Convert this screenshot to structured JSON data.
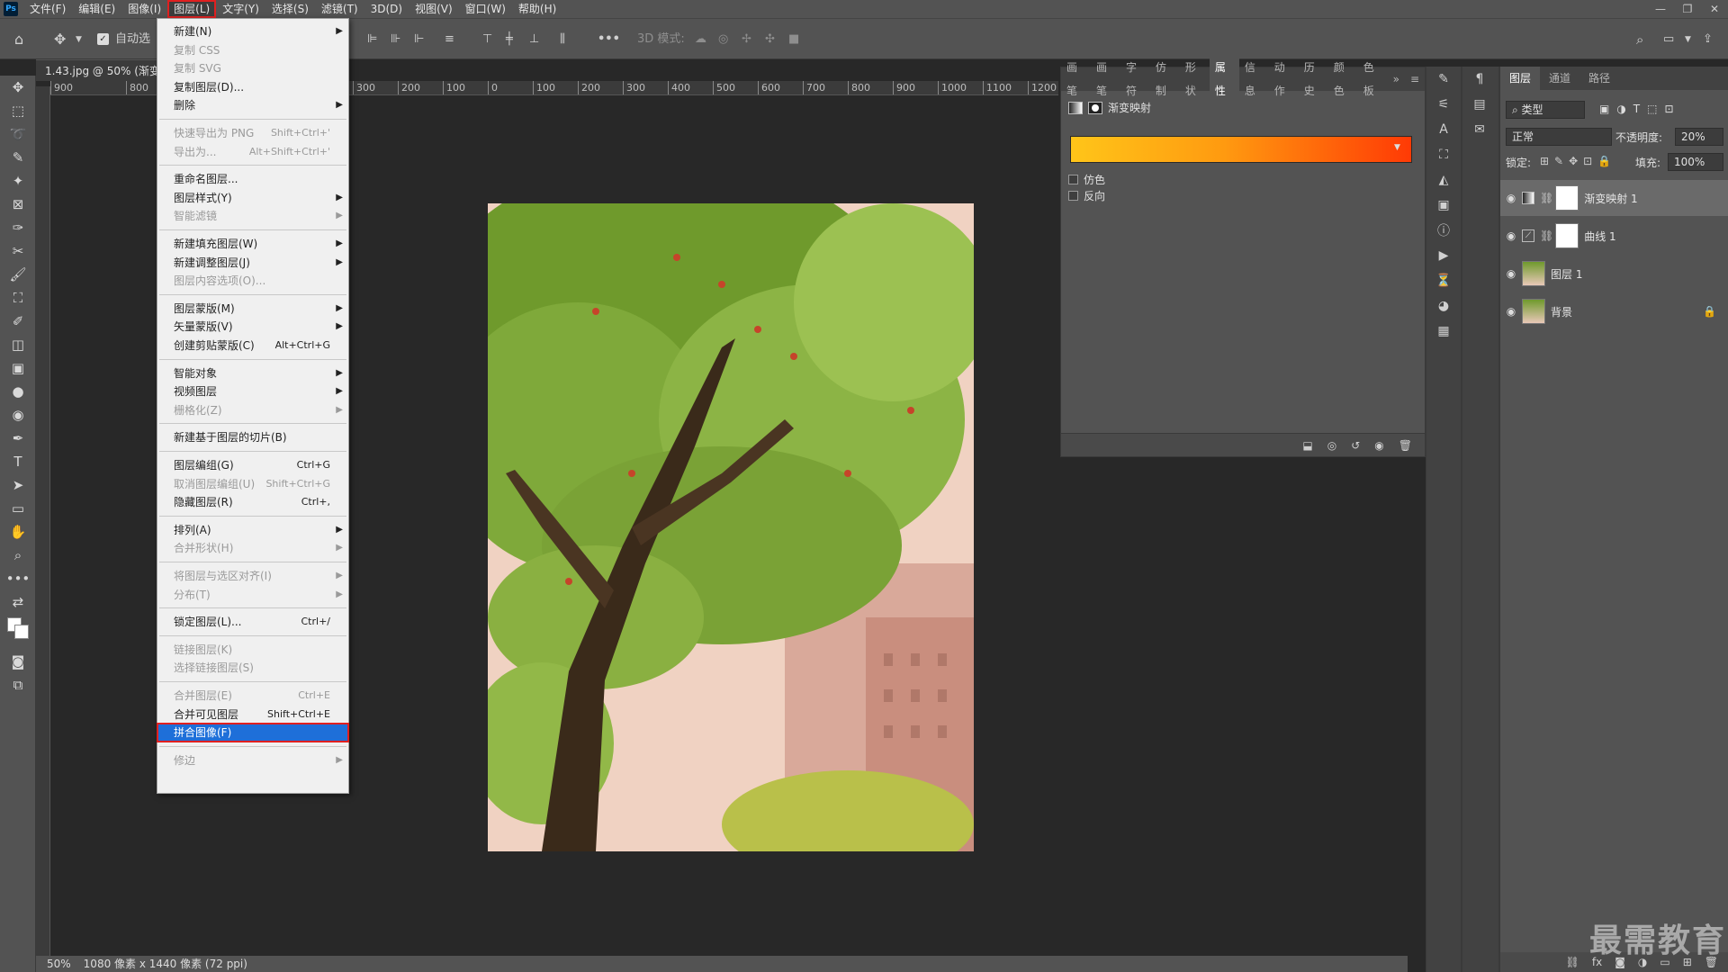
{
  "menubar": {
    "app_logo": "Ps",
    "items": [
      "文件(F)",
      "编辑(E)",
      "图像(I)",
      "图层(L)",
      "文字(Y)",
      "选择(S)",
      "滤镜(T)",
      "3D(D)",
      "视图(V)",
      "窗口(W)",
      "帮助(H)"
    ],
    "window_controls": [
      "—",
      "❐",
      "✕"
    ]
  },
  "options_bar": {
    "auto_select_label": "自动选",
    "mode_3d_label": "3D 模式:"
  },
  "document": {
    "tab_title": "1.43.jpg @ 50% (渐变",
    "ruler_ticks": [
      "900",
      "800",
      "",
      "300",
      "200",
      "100",
      "0",
      "100",
      "200",
      "300",
      "400",
      "500",
      "600",
      "700",
      "800",
      "900",
      "1000",
      "1100",
      "1200"
    ]
  },
  "layer_menu": {
    "items": [
      {
        "label": "新建(N)",
        "submenu": true,
        "disabled": false
      },
      {
        "label": "复制 CSS",
        "disabled": true
      },
      {
        "label": "复制 SVG",
        "disabled": true
      },
      {
        "label": "复制图层(D)...",
        "disabled": false
      },
      {
        "label": "删除",
        "submenu": true,
        "disabled": false
      },
      {
        "sep": true
      },
      {
        "label": "快速导出为 PNG",
        "shortcut": "Shift+Ctrl+'",
        "disabled": true
      },
      {
        "label": "导出为...",
        "shortcut": "Alt+Shift+Ctrl+'",
        "disabled": true
      },
      {
        "sep": true
      },
      {
        "label": "重命名图层...",
        "disabled": false
      },
      {
        "label": "图层样式(Y)",
        "submenu": true,
        "disabled": false
      },
      {
        "label": "智能滤镜",
        "submenu": true,
        "disabled": true
      },
      {
        "sep": true
      },
      {
        "label": "新建填充图层(W)",
        "submenu": true,
        "disabled": false
      },
      {
        "label": "新建调整图层(J)",
        "submenu": true,
        "disabled": false
      },
      {
        "label": "图层内容选项(O)...",
        "disabled": true
      },
      {
        "sep": true
      },
      {
        "label": "图层蒙版(M)",
        "submenu": true,
        "disabled": false
      },
      {
        "label": "矢量蒙版(V)",
        "submenu": true,
        "disabled": false
      },
      {
        "label": "创建剪贴蒙版(C)",
        "shortcut": "Alt+Ctrl+G",
        "disabled": false
      },
      {
        "sep": true
      },
      {
        "label": "智能对象",
        "submenu": true,
        "disabled": false
      },
      {
        "label": "视频图层",
        "submenu": true,
        "disabled": false
      },
      {
        "label": "栅格化(Z)",
        "submenu": true,
        "disabled": true
      },
      {
        "sep": true
      },
      {
        "label": "新建基于图层的切片(B)",
        "disabled": false
      },
      {
        "sep": true
      },
      {
        "label": "图层编组(G)",
        "shortcut": "Ctrl+G",
        "disabled": false
      },
      {
        "label": "取消图层编组(U)",
        "shortcut": "Shift+Ctrl+G",
        "disabled": true
      },
      {
        "label": "隐藏图层(R)",
        "shortcut": "Ctrl+,",
        "disabled": false
      },
      {
        "sep": true
      },
      {
        "label": "排列(A)",
        "submenu": true,
        "disabled": false
      },
      {
        "label": "合并形状(H)",
        "submenu": true,
        "disabled": true
      },
      {
        "sep": true
      },
      {
        "label": "将图层与选区对齐(I)",
        "submenu": true,
        "disabled": true
      },
      {
        "label": "分布(T)",
        "submenu": true,
        "disabled": true
      },
      {
        "sep": true
      },
      {
        "label": "锁定图层(L)...",
        "shortcut": "Ctrl+/",
        "disabled": false
      },
      {
        "sep": true
      },
      {
        "label": "链接图层(K)",
        "disabled": true
      },
      {
        "label": "选择链接图层(S)",
        "disabled": true
      },
      {
        "sep": true
      },
      {
        "label": "合并图层(E)",
        "shortcut": "Ctrl+E",
        "disabled": true
      },
      {
        "label": "合并可见图层",
        "shortcut": "Shift+Ctrl+E",
        "disabled": false
      },
      {
        "label": "拼合图像(F)",
        "disabled": false,
        "highlighted": true
      },
      {
        "sep": true
      },
      {
        "label": "修边",
        "submenu": true,
        "disabled": true
      }
    ]
  },
  "properties_panel": {
    "tabs": [
      "画笔",
      "画笔",
      "字符",
      "仿制",
      "形状",
      "属性",
      "信息",
      "动作",
      "历史",
      "颜色",
      "色板"
    ],
    "active_tab": "属性",
    "adjustment_title": "渐变映射",
    "gradient_colors": [
      "#ffc519",
      "#ff9a10",
      "#ff3a05"
    ],
    "dither_label": "仿色",
    "reverse_label": "反向"
  },
  "layers_panel": {
    "tabs": [
      "图层",
      "通道",
      "路径"
    ],
    "filter_kind": "类型",
    "blend_mode": "正常",
    "opacity_label": "不透明度:",
    "opacity_value": "20%",
    "lock_label": "锁定:",
    "fill_label": "填充:",
    "fill_value": "100%",
    "layers": [
      {
        "name": "渐变映射 1",
        "type": "adjustment",
        "selected": true
      },
      {
        "name": "曲线 1",
        "type": "adjustment",
        "selected": false
      },
      {
        "name": "图层 1",
        "type": "pixel",
        "selected": false
      },
      {
        "name": "背景",
        "type": "pixel",
        "locked": true,
        "selected": false
      }
    ]
  },
  "status_bar": {
    "zoom": "50%",
    "doc_info": "1080 像素 x 1440 像素 (72 ppi)"
  },
  "watermark": "最需教育"
}
